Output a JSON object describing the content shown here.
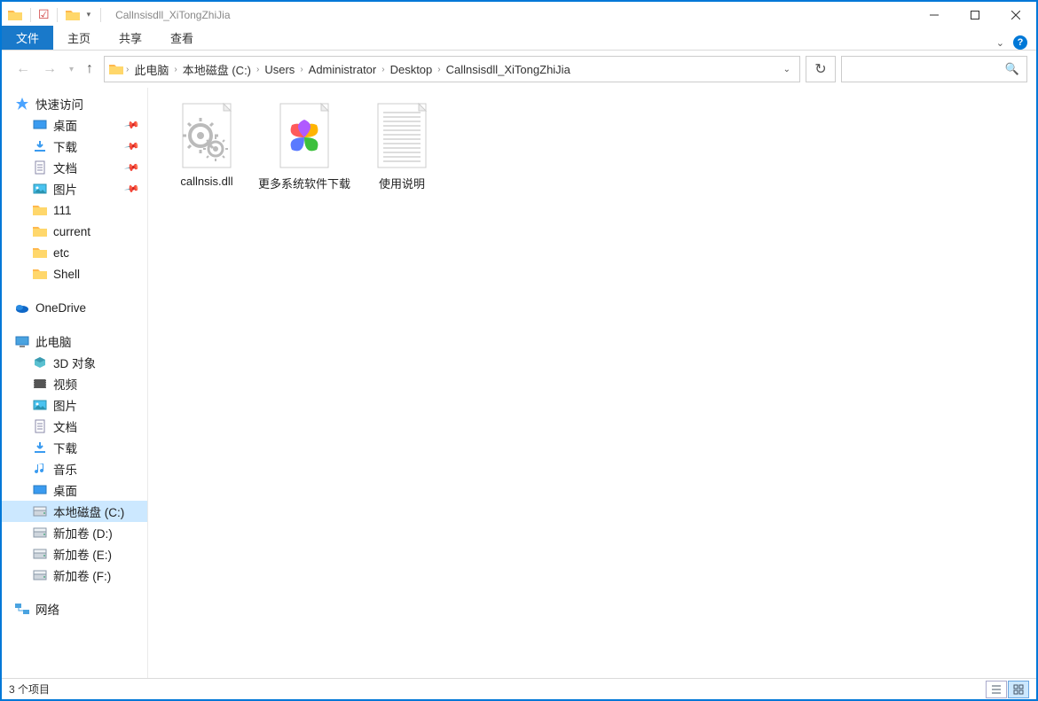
{
  "window_title": "Callnsisdll_XiTongZhiJia",
  "ribbon": {
    "file_tab": "文件",
    "tabs": [
      "主页",
      "共享",
      "查看"
    ]
  },
  "nav": {
    "back_enabled": false,
    "forward_enabled": false,
    "up_enabled": true
  },
  "breadcrumbs": [
    "此电脑",
    "本地磁盘 (C:)",
    "Users",
    "Administrator",
    "Desktop",
    "Callnsisdll_XiTongZhiJia"
  ],
  "sidebar": {
    "quick_access": "快速访问",
    "quick_items": [
      {
        "label": "桌面",
        "icon": "desktop",
        "pinned": true
      },
      {
        "label": "下载",
        "icon": "download",
        "pinned": true
      },
      {
        "label": "文档",
        "icon": "document",
        "pinned": true
      },
      {
        "label": "图片",
        "icon": "pictures",
        "pinned": true
      },
      {
        "label": "111",
        "icon": "folder",
        "pinned": false
      },
      {
        "label": "current",
        "icon": "folder",
        "pinned": false
      },
      {
        "label": "etc",
        "icon": "folder",
        "pinned": false
      },
      {
        "label": "Shell",
        "icon": "folder",
        "pinned": false
      }
    ],
    "onedrive": "OneDrive",
    "this_pc": "此电脑",
    "pc_items": [
      {
        "label": "3D 对象",
        "icon": "3d"
      },
      {
        "label": "视频",
        "icon": "video"
      },
      {
        "label": "图片",
        "icon": "pictures"
      },
      {
        "label": "文档",
        "icon": "document"
      },
      {
        "label": "下载",
        "icon": "download"
      },
      {
        "label": "音乐",
        "icon": "music"
      },
      {
        "label": "桌面",
        "icon": "desktop"
      },
      {
        "label": "本地磁盘 (C:)",
        "icon": "drive",
        "selected": true
      },
      {
        "label": "新加卷 (D:)",
        "icon": "drive"
      },
      {
        "label": "新加卷 (E:)",
        "icon": "drive"
      },
      {
        "label": "新加卷 (F:)",
        "icon": "drive"
      }
    ],
    "network": "网络"
  },
  "files": [
    {
      "name": "callnsis.dll",
      "icon": "dll"
    },
    {
      "name": "更多系统软件下载",
      "icon": "pinwheel"
    },
    {
      "name": "使用说明",
      "icon": "text"
    }
  ],
  "status": {
    "item_count": "3 个项目"
  }
}
